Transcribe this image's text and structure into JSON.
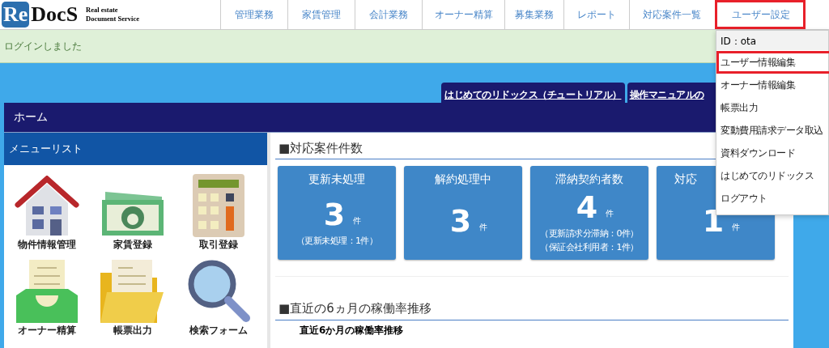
{
  "logo": {
    "mark": "Re",
    "name": "DocS",
    "tagline_1": "Real estate",
    "tagline_2": "Document Service"
  },
  "nav": [
    {
      "label": "管理業務",
      "highlighted": false
    },
    {
      "label": "家賃管理",
      "highlighted": false
    },
    {
      "label": "会計業務",
      "highlighted": false
    },
    {
      "label": "オーナー精算",
      "highlighted": false
    },
    {
      "label": "募集業務",
      "highlighted": false
    },
    {
      "label": "レポート",
      "highlighted": false
    },
    {
      "label": "対応案件一覧",
      "highlighted": false
    },
    {
      "label": "ユーザー設定",
      "highlighted": true
    }
  ],
  "notice": "ログインしました",
  "help_tabs": [
    "はじめてのリドックス（チュートリアル）",
    "操作マニュアルの"
  ],
  "home_title": "ホーム",
  "menu": {
    "title": "メニューリスト",
    "items": [
      {
        "label": "物件情報管理",
        "kind": "house"
      },
      {
        "label": "家賃登録",
        "kind": "money"
      },
      {
        "label": "取引登録",
        "kind": "calculator"
      },
      {
        "label": "オーナー精算",
        "kind": "tray"
      },
      {
        "label": "帳票出力",
        "kind": "folder"
      },
      {
        "label": "検索フォーム",
        "kind": "search"
      }
    ]
  },
  "cases": {
    "title": "■対応案件件数",
    "cards": [
      {
        "title": "更新未処理",
        "count": "3",
        "unit": "件",
        "notes": [
          "（更新未処理：1件）"
        ]
      },
      {
        "title": "解約処理中",
        "count": "3",
        "unit": "件"
      },
      {
        "title": "滞納契約者数",
        "count": "4",
        "unit": "件",
        "notes": [
          "（更新請求分滞納：0件）",
          "（保証会社利用者：1件）"
        ]
      },
      {
        "title": "対応",
        "count": "1",
        "unit": "件"
      }
    ]
  },
  "utilization": {
    "title": "■直近の6ヵ月の稼働率推移",
    "chart_title": "直近6か月の稼働率推移"
  },
  "user_menu": {
    "id": "ID：ota",
    "items": [
      {
        "label": "ユーザー情報編集",
        "highlighted": true
      },
      {
        "label": "オーナー情報編集",
        "highlighted": false
      },
      {
        "label": "帳票出力",
        "highlighted": false
      },
      {
        "label": "変動費用請求データ取込",
        "highlighted": false
      },
      {
        "label": "資料ダウンロード",
        "highlighted": false
      },
      {
        "label": "はじめてのリドックス",
        "highlighted": false
      },
      {
        "label": "ログアウト",
        "highlighted": false
      }
    ]
  }
}
